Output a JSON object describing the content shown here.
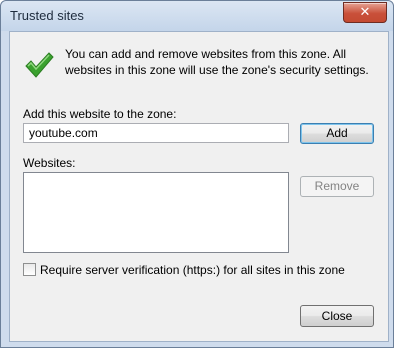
{
  "window": {
    "title": "Trusted sites",
    "close_glyph": "✕"
  },
  "intro": {
    "icon": "green-checkmark-icon",
    "text": "You can add and remove websites from this zone. All websites in this zone will use the zone's security settings."
  },
  "add_section": {
    "label": "Add this website to the zone:",
    "value": "youtube.com",
    "add_button": "Add"
  },
  "websites": {
    "label": "Websites:",
    "items": [],
    "remove_button": "Remove"
  },
  "verification": {
    "checked": false,
    "label": "Require server verification (https:) for all sites in this zone"
  },
  "footer": {
    "close_button": "Close"
  },
  "colors": {
    "accent": "#3c7fb1",
    "check_green": "#3aa12e",
    "close_red": "#c9503a"
  }
}
